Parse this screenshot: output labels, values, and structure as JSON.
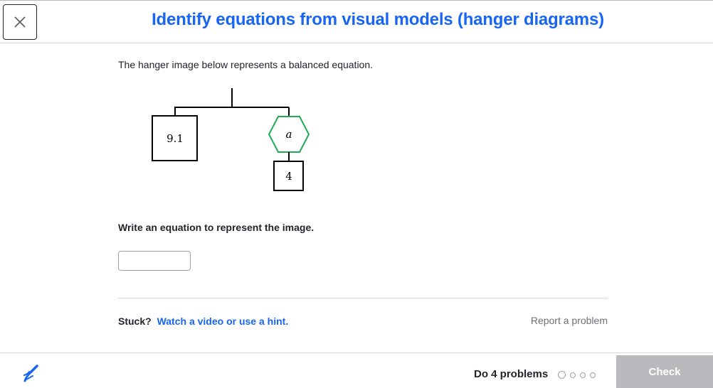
{
  "header": {
    "title": "Identify equations from visual models (hanger diagrams)",
    "close_icon": "close-icon"
  },
  "problem": {
    "prompt": "The hanger image below represents a balanced equation.",
    "hanger": {
      "left_box_value": "9.1",
      "right_hexagon_label": "a",
      "right_box_value": "4",
      "hexagon_color": "#1fab54"
    },
    "question": "Write an equation to represent the image.",
    "answer_value": ""
  },
  "help": {
    "stuck_label": "Stuck?",
    "hint_link": "Watch a video or use a hint.",
    "report_link": "Report a problem"
  },
  "footer": {
    "pencil_icon": "pencil-icon",
    "do_problems": "Do 4 problems",
    "progress": {
      "total": 4,
      "completed": 0
    },
    "check_button": "Check"
  },
  "colors": {
    "accent": "#1865f2",
    "disabled": "#bababe"
  }
}
